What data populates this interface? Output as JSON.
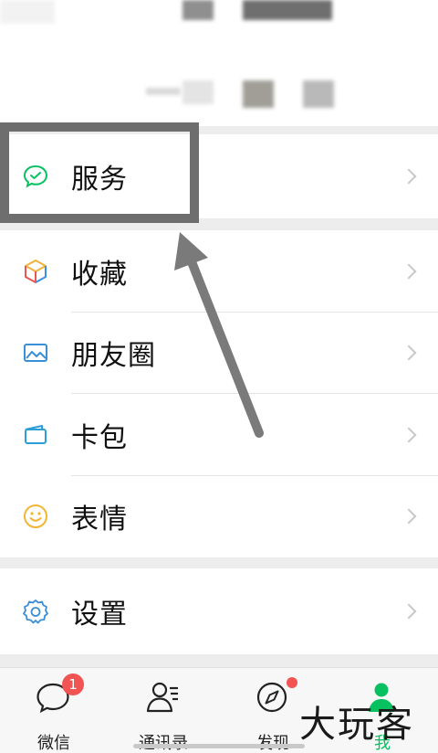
{
  "menu": {
    "services": "服务",
    "favorites": "收藏",
    "moments": "朋友圈",
    "cards": "卡包",
    "stickers": "表情",
    "settings": "设置"
  },
  "tabbar": {
    "chats": "微信",
    "chats_badge": "1",
    "contacts": "通讯录",
    "discover": "发现",
    "me": "我"
  },
  "watermark": "大玩客",
  "colors": {
    "brand_green": "#07c160",
    "badge_red": "#f25353",
    "annotation_gray": "#6e6e6e"
  },
  "icons": {
    "services": "wechat-pay-icon",
    "favorites": "cube-icon",
    "moments": "photo-icon",
    "cards": "card-icon",
    "stickers": "smiley-icon",
    "settings": "gear-icon"
  }
}
